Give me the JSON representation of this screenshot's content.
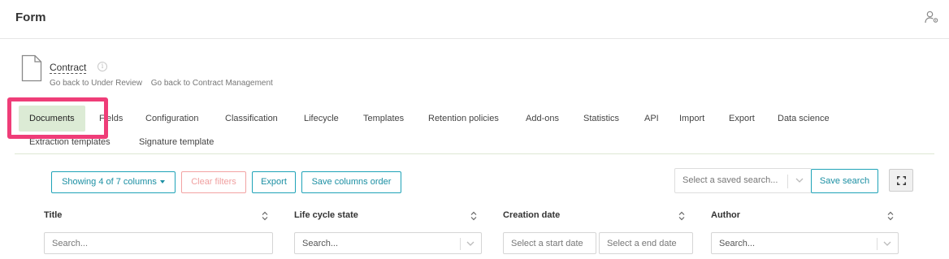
{
  "header": {
    "title": "Form",
    "user_icon": "user-settings-icon"
  },
  "document": {
    "name": "Contract",
    "back_links": [
      "Go back to Under Review",
      "Go back to Contract Management"
    ]
  },
  "tabs": [
    {
      "label": "Documents",
      "active": true
    },
    {
      "label": "Fields"
    },
    {
      "label": "Configuration"
    },
    {
      "label": "Classification"
    },
    {
      "label": "Lifecycle"
    },
    {
      "label": "Templates"
    },
    {
      "label": "Retention policies"
    },
    {
      "label": "Add-ons"
    },
    {
      "label": "Statistics"
    },
    {
      "label": "API"
    },
    {
      "label": "Import"
    },
    {
      "label": "Export"
    },
    {
      "label": "Data science"
    },
    {
      "label": "Extraction templates"
    },
    {
      "label": "Signature template"
    }
  ],
  "toolbar": {
    "columns_label": "Showing 4 of 7 columns",
    "clear_filters_label": "Clear filters",
    "export_label": "Export",
    "save_columns_label": "Save columns order",
    "saved_search_placeholder": "Select a saved search...",
    "save_search_label": "Save search"
  },
  "table": {
    "columns": [
      {
        "title": "Title",
        "filter_placeholder": "Search..."
      },
      {
        "title": "Life cycle state",
        "filter_placeholder": "Search..."
      },
      {
        "title": "Creation date",
        "start_placeholder": "Select a start date",
        "end_placeholder": "Select a end date"
      },
      {
        "title": "Author",
        "filter_placeholder": "Search..."
      }
    ]
  },
  "colors": {
    "accent": "#1fa3b8",
    "active_tab_bg": "#dcebd5",
    "highlight": "#ef3d78",
    "disabled_border": "#f2a3a3"
  }
}
